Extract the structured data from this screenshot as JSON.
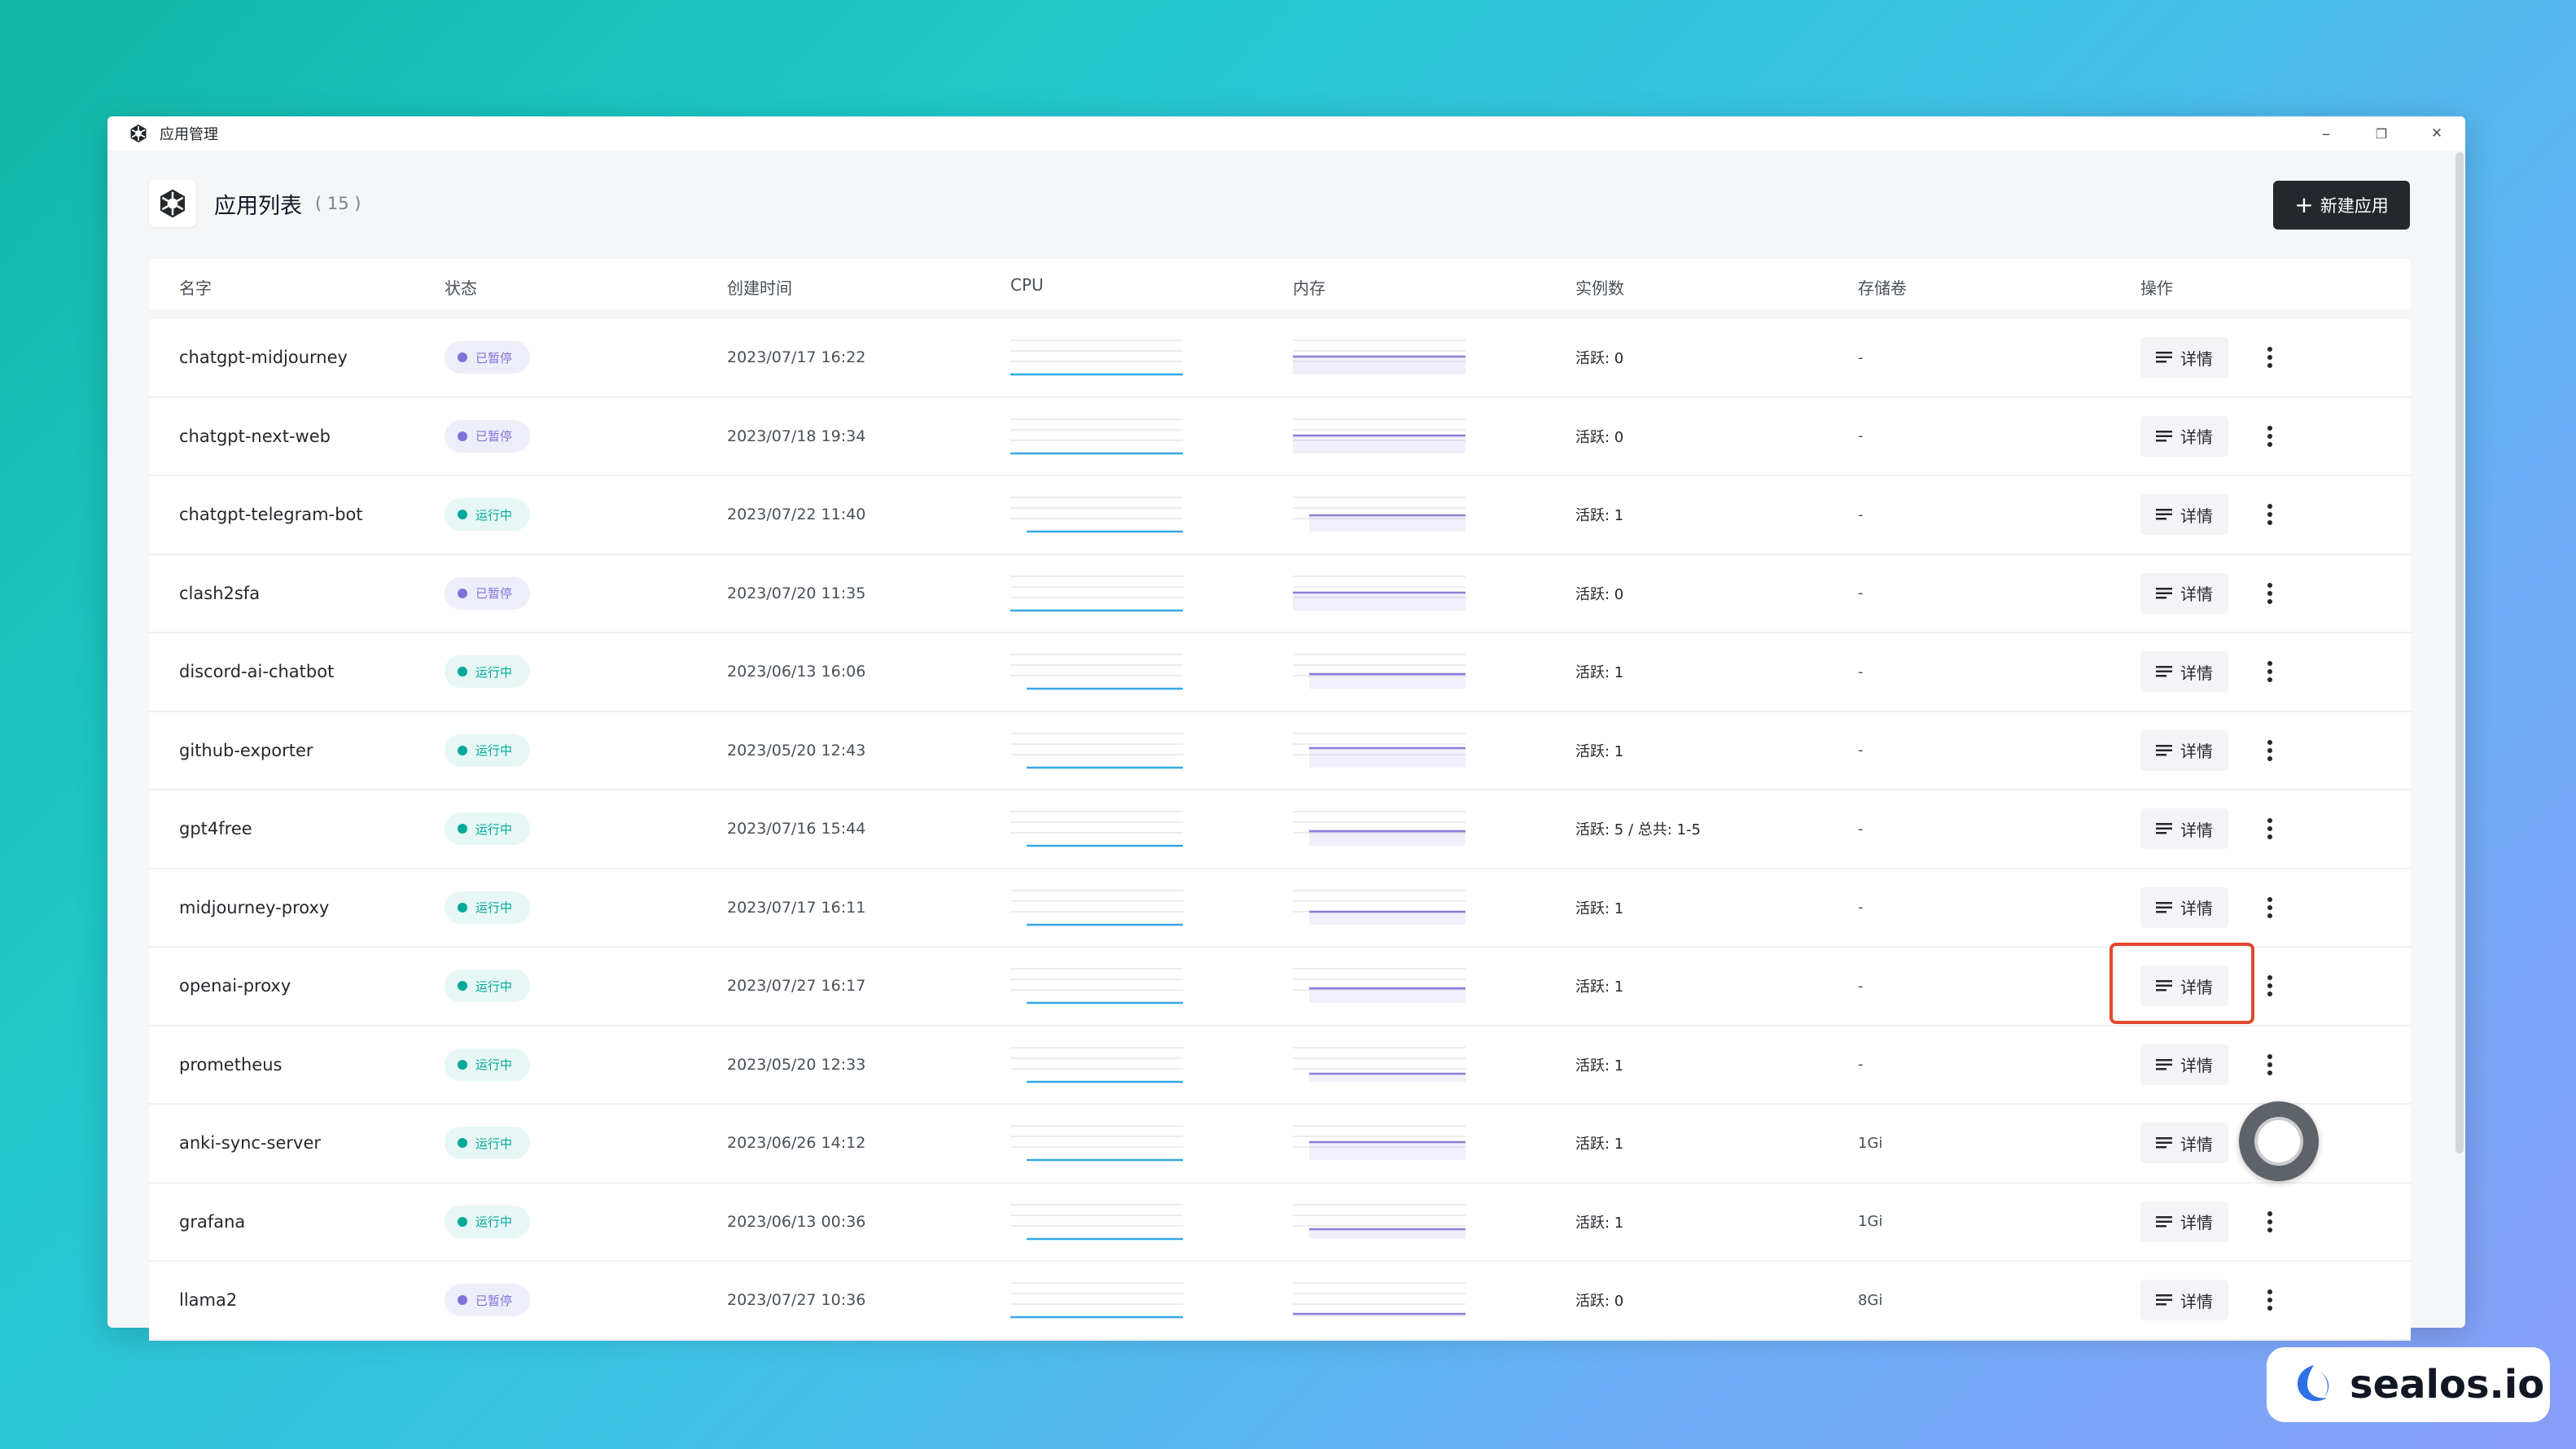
{
  "window": {
    "title": "应用管理",
    "controls": {
      "minimize": "–",
      "restore": "❐",
      "close": "✕"
    }
  },
  "header": {
    "title": "应用列表",
    "count": "( 15 )",
    "new_button": "新建应用"
  },
  "columns": [
    "名字",
    "状态",
    "创建时间",
    "CPU",
    "内存",
    "实例数",
    "存储卷",
    "操作"
  ],
  "detail_label": "详情",
  "brand": {
    "text": "sealos.io"
  },
  "colors": {
    "cpu": "#36a7e6",
    "memory": "#8b7ed8",
    "running": "#00a89a",
    "paused": "#8172d8",
    "highlight": "#e0492f"
  },
  "apps": [
    {
      "name": "chatgpt-midjourney",
      "status": "已暂停",
      "state": "paused",
      "created": "2023/07/17 16:22",
      "replicas": "活跃: 0",
      "storage": "-"
    },
    {
      "name": "chatgpt-next-web",
      "status": "已暂停",
      "state": "paused",
      "created": "2023/07/18 19:34",
      "replicas": "活跃: 0",
      "storage": "-"
    },
    {
      "name": "chatgpt-telegram-bot",
      "status": "运行中",
      "state": "running",
      "created": "2023/07/22 11:40",
      "replicas": "活跃: 1",
      "storage": "-"
    },
    {
      "name": "clash2sfa",
      "status": "已暂停",
      "state": "paused",
      "created": "2023/07/20 11:35",
      "replicas": "活跃: 0",
      "storage": "-"
    },
    {
      "name": "discord-ai-chatbot",
      "status": "运行中",
      "state": "running",
      "created": "2023/06/13 16:06",
      "replicas": "活跃: 1",
      "storage": "-"
    },
    {
      "name": "github-exporter",
      "status": "运行中",
      "state": "running",
      "created": "2023/05/20 12:43",
      "replicas": "活跃: 1",
      "storage": "-"
    },
    {
      "name": "gpt4free",
      "status": "运行中",
      "state": "running",
      "created": "2023/07/16 15:44",
      "replicas": "活跃: 5 / 总共: 1-5",
      "storage": "-"
    },
    {
      "name": "midjourney-proxy",
      "status": "运行中",
      "state": "running",
      "created": "2023/07/17 16:11",
      "replicas": "活跃: 1",
      "storage": "-"
    },
    {
      "name": "openai-proxy",
      "status": "运行中",
      "state": "running",
      "created": "2023/07/27 16:17",
      "replicas": "活跃: 1",
      "storage": "-"
    },
    {
      "name": "prometheus",
      "status": "运行中",
      "state": "running",
      "created": "2023/05/20 12:33",
      "replicas": "活跃: 1",
      "storage": "-"
    },
    {
      "name": "anki-sync-server",
      "status": "运行中",
      "state": "running",
      "created": "2023/06/26 14:12",
      "replicas": "活跃: 1",
      "storage": "1Gi"
    },
    {
      "name": "grafana",
      "status": "运行中",
      "state": "running",
      "created": "2023/06/13 00:36",
      "replicas": "活跃: 1",
      "storage": "1Gi"
    },
    {
      "name": "llama2",
      "status": "已暂停",
      "state": "paused",
      "created": "2023/07/27 10:36",
      "replicas": "活跃: 0",
      "storage": "8Gi"
    }
  ]
}
